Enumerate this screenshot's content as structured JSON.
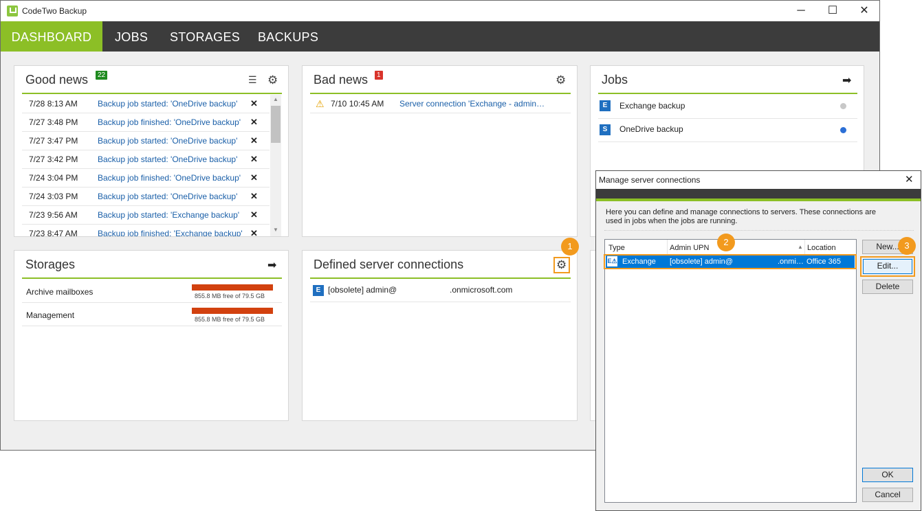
{
  "window": {
    "title": "CodeTwo Backup",
    "controls": {
      "minimize": "─",
      "maximize": "☐",
      "close": "✕"
    }
  },
  "nav": {
    "tabs": [
      {
        "label": "DASHBOARD",
        "active": true
      },
      {
        "label": "JOBS"
      },
      {
        "label": "STORAGES"
      },
      {
        "label": "BACKUPS"
      }
    ]
  },
  "good_news": {
    "title": "Good news",
    "count": "22",
    "items": [
      {
        "time": "7/28 8:13 AM",
        "text": "Backup job started: 'OneDrive backup'"
      },
      {
        "time": "7/27 3:48 PM",
        "text": "Backup job finished: 'OneDrive backup'"
      },
      {
        "time": "7/27 3:47 PM",
        "text": "Backup job started: 'OneDrive backup'"
      },
      {
        "time": "7/27 3:42 PM",
        "text": "Backup job started: 'OneDrive backup'"
      },
      {
        "time": "7/24 3:04 PM",
        "text": "Backup job finished: 'OneDrive backup'"
      },
      {
        "time": "7/24 3:03 PM",
        "text": "Backup job started: 'OneDrive backup'"
      },
      {
        "time": "7/23 9:56 AM",
        "text": "Backup job started: 'Exchange backup'"
      },
      {
        "time": "7/23 8:47 AM",
        "text": "Backup job finished: 'Exchange backup'"
      }
    ]
  },
  "bad_news": {
    "title": "Bad news",
    "count": "1",
    "items": [
      {
        "time": "7/10 10:45 AM",
        "text": "Server connection 'Exchange - admin…"
      }
    ]
  },
  "jobs": {
    "title": "Jobs",
    "items": [
      {
        "name": "Exchange backup",
        "icon": "E",
        "status_color": "#c8c8c8"
      },
      {
        "name": "OneDrive backup",
        "icon": "S",
        "status_color": "#2b6fd6"
      }
    ]
  },
  "storages": {
    "title": "Storages",
    "items": [
      {
        "name": "Archive mailboxes",
        "free": "855.8 MB free of 79.5 GB"
      },
      {
        "name": "Management",
        "free": "855.8 MB free of 79.5 GB"
      }
    ]
  },
  "connections": {
    "title": "Defined server connections",
    "items": [
      {
        "prefix": "[obsolete] admin@",
        "domain": ".onmicrosoft.com"
      }
    ]
  },
  "dialog": {
    "title": "Manage server connections",
    "description": "Here you can define and manage connections to servers. These connections are used in jobs when the jobs are running.",
    "columns": [
      "Type",
      "Admin UPN",
      "Location"
    ],
    "rows": [
      {
        "type": "Exchange",
        "upn": "[obsolete] admin@",
        "upn_suffix": ".onmi…",
        "location": "Office 365"
      }
    ],
    "buttons": {
      "new": "New...",
      "edit": "Edit...",
      "delete": "Delete",
      "ok": "OK",
      "cancel": "Cancel"
    }
  },
  "callouts": [
    "1",
    "2",
    "3"
  ],
  "colors": {
    "accent": "#8cbf26",
    "callout": "#f29a1e",
    "selection": "#0078d7"
  }
}
